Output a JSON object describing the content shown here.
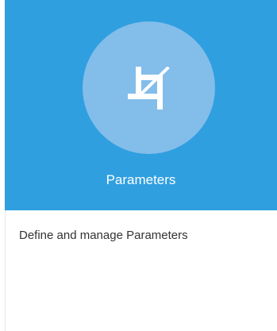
{
  "tile": {
    "icon": "crop-icon",
    "title": "Parameters",
    "description": "Define and manage Parameters",
    "colors": {
      "header": "#2f9fe0",
      "icon_circle": "#83bdea",
      "title_text": "#ffffff",
      "description_text": "#333333"
    }
  }
}
